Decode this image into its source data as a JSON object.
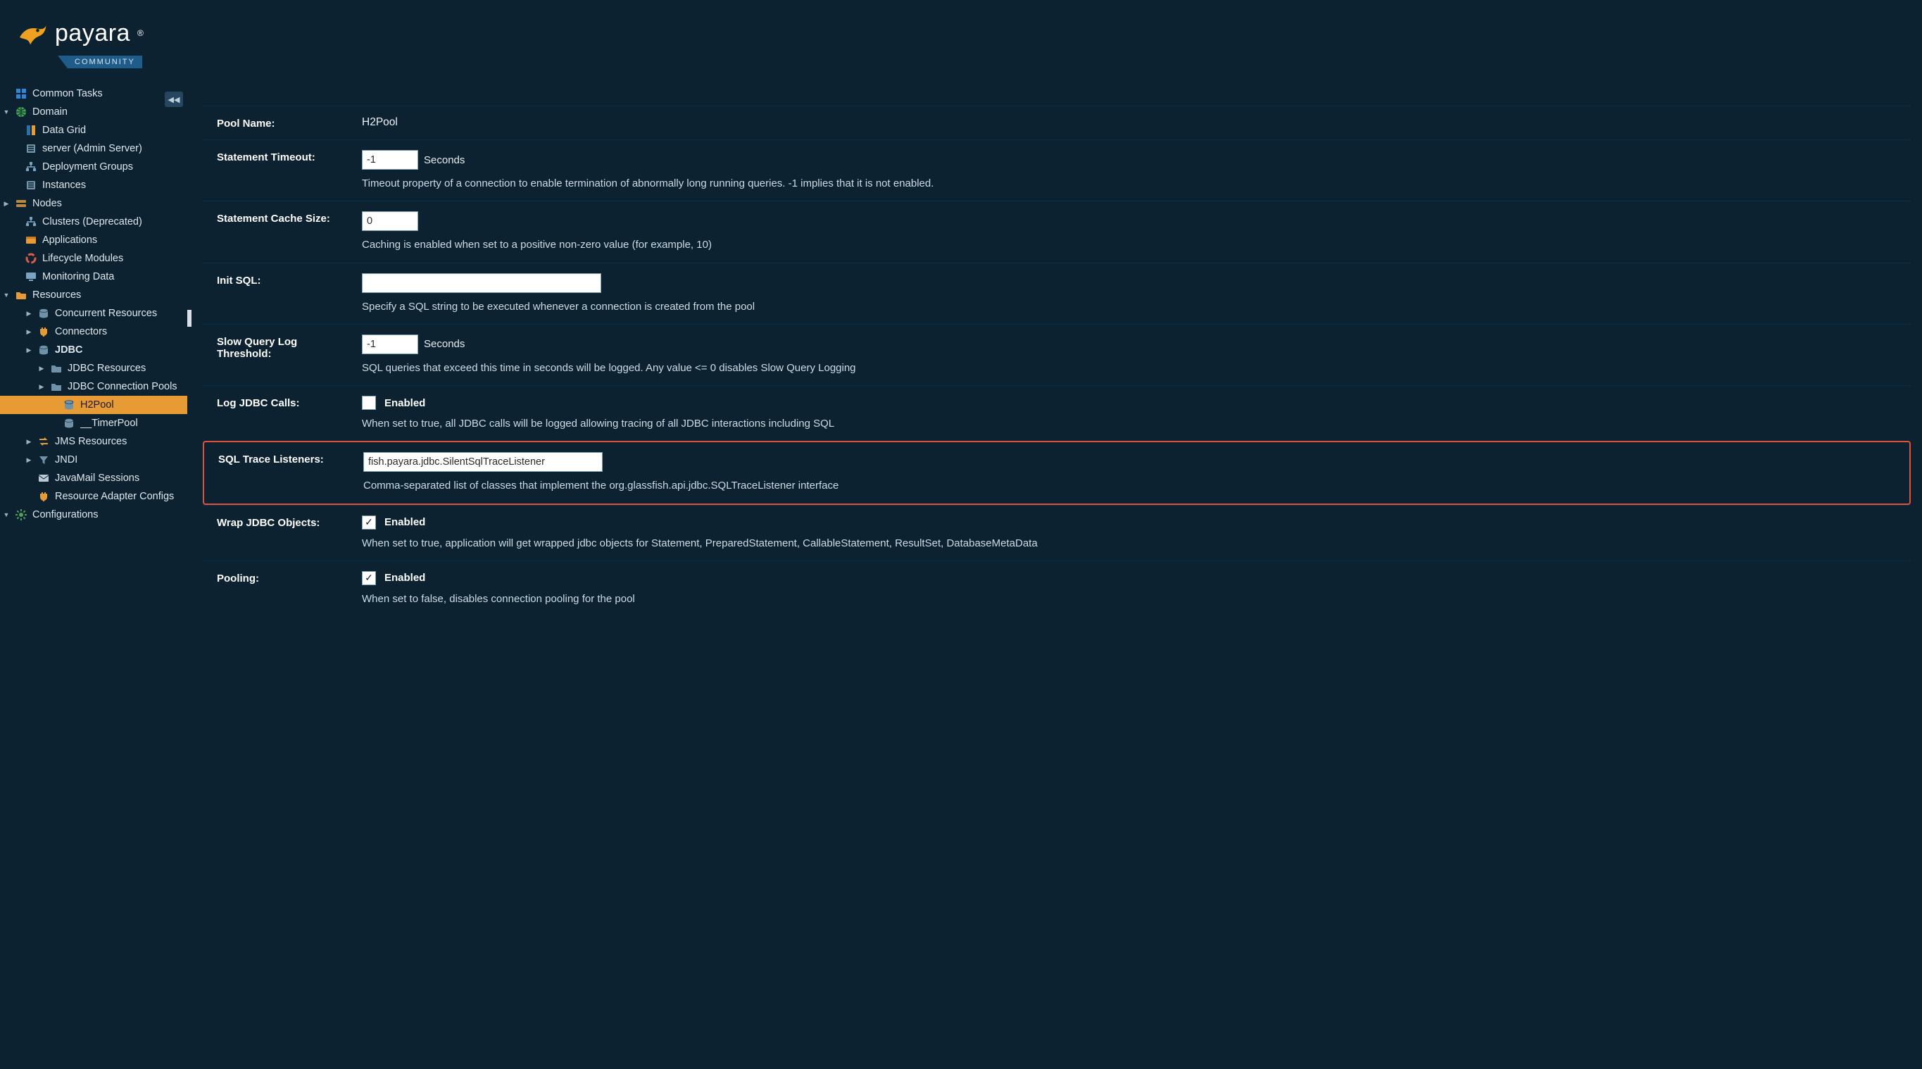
{
  "brand": {
    "name": "payara",
    "edition": "COMMUNITY"
  },
  "sidebar": {
    "items": [
      {
        "label": "Common Tasks",
        "indent": 0,
        "toggle": "",
        "icon": "grid-icon",
        "color": "#2e86d8"
      },
      {
        "label": "Domain",
        "indent": 0,
        "toggle": "▼",
        "icon": "globe-icon",
        "color": "#3fa34d"
      },
      {
        "label": "Data Grid",
        "indent": 1,
        "toggle": "",
        "icon": "data-grid-icon",
        "color": "#3a7db8"
      },
      {
        "label": "server (Admin Server)",
        "indent": 1,
        "toggle": "",
        "icon": "server-icon",
        "color": "#6f92a6"
      },
      {
        "label": "Deployment Groups",
        "indent": 1,
        "toggle": "",
        "icon": "org-icon",
        "color": "#7aa5c2"
      },
      {
        "label": "Instances",
        "indent": 1,
        "toggle": "",
        "icon": "server-icon",
        "color": "#6f92a6"
      },
      {
        "label": "Nodes",
        "indent": 0,
        "toggle": "▶",
        "icon": "nodes-icon",
        "color": "#b78a3e"
      },
      {
        "label": "Clusters (Deprecated)",
        "indent": 1,
        "toggle": "",
        "icon": "org-icon",
        "color": "#7aa5c2"
      },
      {
        "label": "Applications",
        "indent": 1,
        "toggle": "",
        "icon": "apps-icon",
        "color": "#e79b34"
      },
      {
        "label": "Lifecycle Modules",
        "indent": 1,
        "toggle": "",
        "icon": "lifecycle-icon",
        "color": "#d85b4d"
      },
      {
        "label": "Monitoring Data",
        "indent": 1,
        "toggle": "",
        "icon": "monitor-icon",
        "color": "#7aa5c2"
      },
      {
        "label": "Resources",
        "indent": 0,
        "toggle": "▼",
        "icon": "folder-icon",
        "color": "#e79b34"
      },
      {
        "label": "Concurrent Resources",
        "indent": 2,
        "toggle": "▶",
        "icon": "db-icon",
        "color": "#6f92a6"
      },
      {
        "label": "Connectors",
        "indent": 2,
        "toggle": "▶",
        "icon": "plug-icon",
        "color": "#e79b34"
      },
      {
        "label": "JDBC",
        "indent": 2,
        "toggle": "▶",
        "icon": "db-icon",
        "color": "#6f92a6",
        "bold": true
      },
      {
        "label": "JDBC Resources",
        "indent": 3,
        "toggle": "▶",
        "icon": "folder2-icon",
        "color": "#6f92a6"
      },
      {
        "label": "JDBC Connection Pools",
        "indent": 3,
        "toggle": "▶",
        "icon": "folder2-icon",
        "color": "#6f92a6"
      },
      {
        "label": "H2Pool",
        "indent": 4,
        "toggle": "",
        "icon": "db-icon",
        "color": "#6f92a6",
        "selected": true
      },
      {
        "label": "__TimerPool",
        "indent": 4,
        "toggle": "",
        "icon": "db-icon",
        "color": "#6f92a6"
      },
      {
        "label": "JMS Resources",
        "indent": 2,
        "toggle": "▶",
        "icon": "swap-icon",
        "color": "#e79b34"
      },
      {
        "label": "JNDI",
        "indent": 2,
        "toggle": "▶",
        "icon": "filter-icon",
        "color": "#6f92a6"
      },
      {
        "label": "JavaMail Sessions",
        "indent": 2,
        "toggle": "",
        "icon": "mail-icon",
        "color": "#bac9d3"
      },
      {
        "label": "Resource Adapter Configs",
        "indent": 2,
        "toggle": "",
        "icon": "plug-icon",
        "color": "#e79b34"
      },
      {
        "label": "Configurations",
        "indent": 0,
        "toggle": "▼",
        "icon": "gear-icon",
        "color": "#4f9f58"
      }
    ]
  },
  "form": {
    "pool_name": {
      "label": "Pool Name:",
      "value": "H2Pool"
    },
    "statement_timeout": {
      "label": "Statement Timeout:",
      "value": "-1",
      "unit": "Seconds",
      "desc": "Timeout property of a connection to enable termination of abnormally long running queries. -1 implies that it is not enabled."
    },
    "statement_cache": {
      "label": "Statement Cache Size:",
      "value": "0",
      "desc": "Caching is enabled when set to a positive non-zero value (for example, 10)"
    },
    "init_sql": {
      "label": "Init SQL:",
      "value": "",
      "desc": "Specify a SQL string to be executed whenever a connection is created from the pool"
    },
    "slow_query": {
      "label": "Slow Query Log Threshold:",
      "value": "-1",
      "unit": "Seconds",
      "desc": "SQL queries that exceed this time in seconds will be logged. Any value <= 0 disables Slow Query Logging"
    },
    "log_jdbc": {
      "label": "Log JDBC Calls:",
      "check_label": "Enabled",
      "checked": false,
      "desc": "When set to true, all JDBC calls will be logged allowing tracing of all JDBC interactions including SQL"
    },
    "sql_trace": {
      "label": "SQL Trace Listeners:",
      "value": "fish.payara.jdbc.SilentSqlTraceListener",
      "desc": "Comma-separated list of classes that implement the org.glassfish.api.jdbc.SQLTraceListener interface"
    },
    "wrap_jdbc": {
      "label": "Wrap JDBC Objects:",
      "check_label": "Enabled",
      "checked": true,
      "desc": "When set to true, application will get wrapped jdbc objects for Statement, PreparedStatement, CallableStatement, ResultSet, DatabaseMetaData"
    },
    "pooling": {
      "label": "Pooling:",
      "check_label": "Enabled",
      "checked": true,
      "desc": "When set to false, disables connection pooling for the pool"
    }
  }
}
